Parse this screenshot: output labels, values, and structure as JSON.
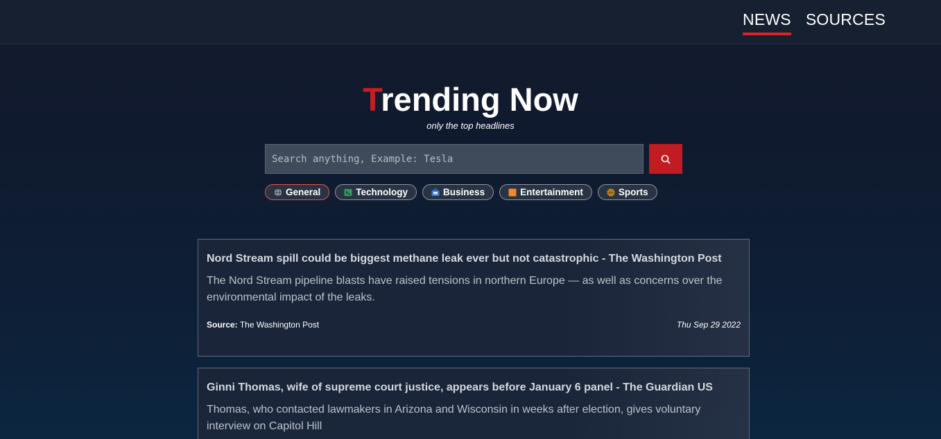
{
  "nav": {
    "items": [
      {
        "label": "NEWS",
        "active": true
      },
      {
        "label": "SOURCES",
        "active": false
      }
    ]
  },
  "hero": {
    "title_first_letter": "T",
    "title_rest": "rending Now",
    "subtitle": "only the top headlines"
  },
  "search": {
    "placeholder": "Search anything, Example: Tesla",
    "button_icon": "search-icon"
  },
  "categories": [
    {
      "label": "General",
      "icon": "globe-icon",
      "active": true
    },
    {
      "label": "Technology",
      "icon": "terminal-icon",
      "active": false
    },
    {
      "label": "Business",
      "icon": "briefcase-icon",
      "active": false
    },
    {
      "label": "Entertainment",
      "icon": "film-icon",
      "active": false
    },
    {
      "label": "Sports",
      "icon": "basketball-icon",
      "active": false
    }
  ],
  "articles": [
    {
      "title": "Nord Stream spill could be biggest methane leak ever but not catastrophic - The Washington Post",
      "description": "The Nord Stream pipeline blasts have raised tensions in northern Europe — as well as concerns over the environmental impact of the leaks.",
      "source_label": "Source:",
      "source": "The Washington Post",
      "date": "Thu Sep 29 2022"
    },
    {
      "title": "Ginni Thomas, wife of supreme court justice, appears before January 6 panel - The Guardian US",
      "description": "Thomas, who contacted lawmakers in Arizona and Wisconsin in weeks after election, gives voluntary interview on Capitol Hill"
    }
  ],
  "colors": {
    "accent": "#c91d22",
    "nav_bg": "#172031",
    "card_border": "#5f6a7b"
  }
}
